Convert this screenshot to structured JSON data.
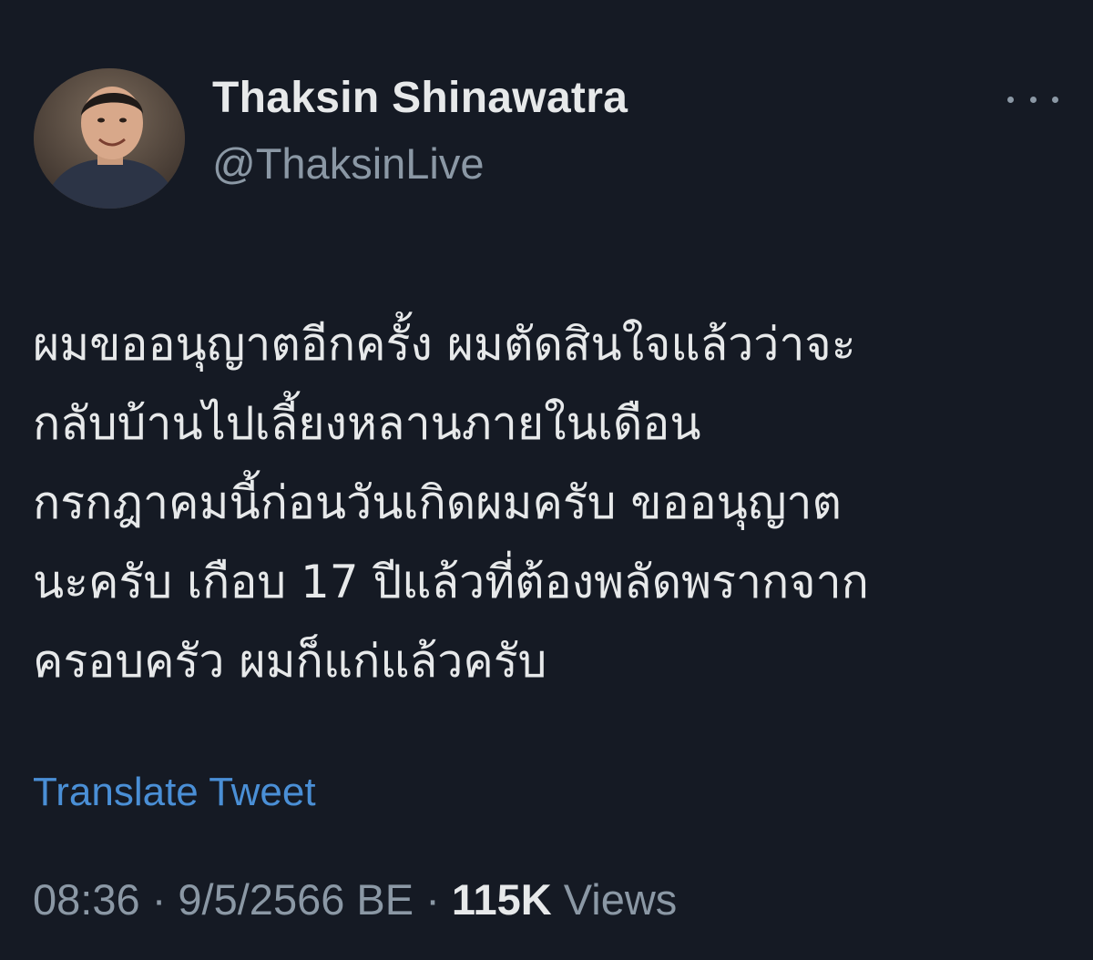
{
  "author": {
    "display_name": "Thaksin Shinawatra",
    "handle": "@ThaksinLive",
    "avatar_icon": "profile-photo"
  },
  "menu": {
    "icon": "more-horizontal-icon"
  },
  "tweet": {
    "lines": [
      "ผมขออนุญาตอีกครั้ง ผมตัดสินใจแล้วว่าจะ",
      "กลับบ้านไปเลี้ยงหลานภายในเดือน",
      "กรกฎาคมนี้ก่อนวันเกิดผมครับ ขออนุญาต",
      "นะครับ เกือบ 17 ปีแล้วที่ต้องพลัดพรากจาก",
      "ครอบครัว ผมก็แก่แล้วครับ"
    ]
  },
  "translate_label": "Translate Tweet",
  "meta": {
    "time": "08:36",
    "separator": "·",
    "date": "9/5/2566 BE",
    "views_count": "115K",
    "views_label": "Views"
  },
  "colors": {
    "background": "#151a24",
    "text_primary": "#e7e9ea",
    "text_secondary": "#8b98a5",
    "link": "#4a8fd6"
  }
}
